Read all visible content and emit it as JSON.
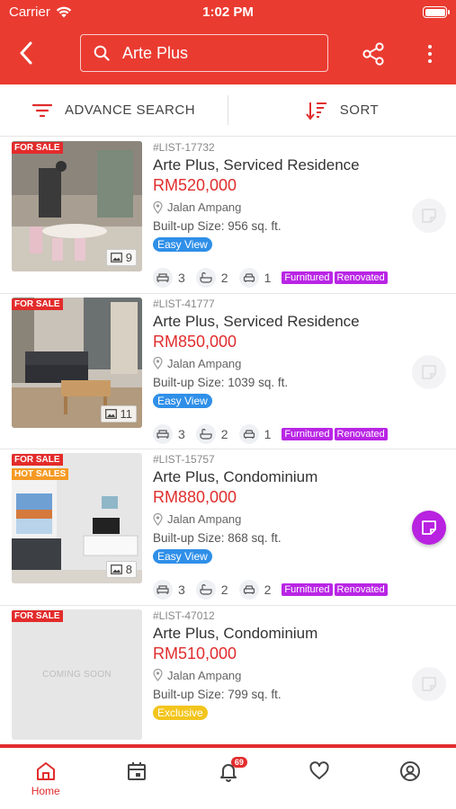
{
  "status_bar": {
    "carrier": "Carrier",
    "time": "1:02 PM"
  },
  "header": {
    "search_text": "Arte Plus"
  },
  "filters": {
    "advance_search": "ADVANCE SEARCH",
    "sort": "SORT"
  },
  "listings": [
    {
      "id": "#LIST-17732",
      "title": "Arte Plus, Serviced Residence",
      "price": "RM520,000",
      "location": "Jalan Ampang",
      "size": "Built-up Size: 956 sq. ft.",
      "tag": "Easy View",
      "badge": "FOR SALE",
      "photo_count": "9",
      "beds": "3",
      "baths": "2",
      "parking": "1",
      "chips": [
        "Furnitured",
        "Renovated"
      ]
    },
    {
      "id": "#LIST-41777",
      "title": "Arte Plus, Serviced Residence",
      "price": "RM850,000",
      "location": "Jalan Ampang",
      "size": "Built-up Size: 1039 sq. ft.",
      "tag": "Easy View",
      "badge": "FOR SALE",
      "photo_count": "11",
      "beds": "3",
      "baths": "2",
      "parking": "1",
      "chips": [
        "Furnitured",
        "Renovated"
      ]
    },
    {
      "id": "#LIST-15757",
      "title": "Arte Plus, Condominium",
      "price": "RM880,000",
      "location": "Jalan Ampang",
      "size": "Built-up Size: 868 sq. ft.",
      "tag": "Easy View",
      "badge": "FOR SALE",
      "badge2": "HOT SALES",
      "photo_count": "8",
      "beds": "3",
      "baths": "2",
      "parking": "2",
      "chips": [
        "Furnitured",
        "Renovated"
      ]
    },
    {
      "id": "#LIST-47012",
      "title": "Arte Plus, Condominium",
      "price": "RM510,000",
      "location": "Jalan Ampang",
      "size": "Built-up Size: 799 sq. ft.",
      "tag": "Exclusive",
      "badge": "FOR SALE",
      "placeholder": "COMING SOON"
    }
  ],
  "bottom_nav": {
    "home_label": "Home",
    "notification_count": "69"
  },
  "colors": {
    "brand": "#ea3b31",
    "price": "#e02d2d",
    "chip": "#b925e5",
    "easy_view": "#2f8fe8",
    "exclusive": "#f3c51c"
  }
}
